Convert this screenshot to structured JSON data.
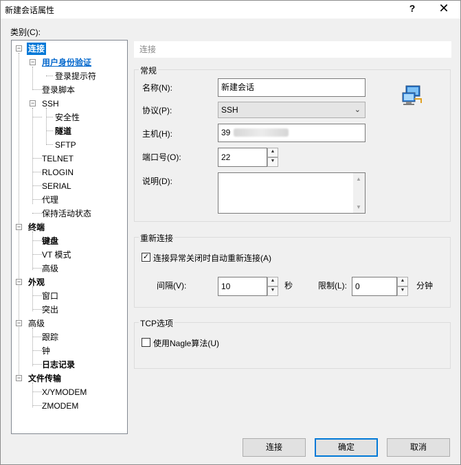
{
  "window": {
    "title": "新建会话属性",
    "help": "?",
    "close": "✕"
  },
  "category_label": "类别(C):",
  "tree": [
    {
      "label": "连接"
    },
    {
      "label": "用户身份验证"
    },
    {
      "label": "登录提示符"
    },
    {
      "label": "登录脚本"
    },
    {
      "label": "SSH"
    },
    {
      "label": "安全性"
    },
    {
      "label": "隧道"
    },
    {
      "label": "SFTP"
    },
    {
      "label": "TELNET"
    },
    {
      "label": "RLOGIN"
    },
    {
      "label": "SERIAL"
    },
    {
      "label": "代理"
    },
    {
      "label": "保持活动状态"
    },
    {
      "label": "终端"
    },
    {
      "label": "键盘"
    },
    {
      "label": "VT 模式"
    },
    {
      "label": "高级"
    },
    {
      "label": "外观"
    },
    {
      "label": "窗口"
    },
    {
      "label": "突出"
    },
    {
      "label": "高级"
    },
    {
      "label": "跟踪"
    },
    {
      "label": "钟"
    },
    {
      "label": "日志记录"
    },
    {
      "label": "文件传输"
    },
    {
      "label": "X/YMODEM"
    },
    {
      "label": "ZMODEM"
    }
  ],
  "section_header": "连接",
  "general": {
    "title": "常规",
    "name_label": "名称(N):",
    "name_value": "新建会话",
    "protocol_label": "协议(P):",
    "protocol_value": "SSH",
    "host_label": "主机(H):",
    "host_value": "39",
    "port_label": "端口号(O):",
    "port_value": "22",
    "desc_label": "说明(D):"
  },
  "reconnect": {
    "title": "重新连接",
    "auto_label": "连接异常关闭时自动重新连接(A)",
    "auto_checked": "✓",
    "interval_label": "间隔(V):",
    "interval_value": "10",
    "interval_unit": "秒",
    "limit_label": "限制(L):",
    "limit_value": "0",
    "limit_unit": "分钟"
  },
  "tcp": {
    "title": "TCP选项",
    "nagle_label": "使用Nagle算法(U)"
  },
  "buttons": {
    "connect": "连接",
    "ok": "确定",
    "cancel": "取消"
  }
}
